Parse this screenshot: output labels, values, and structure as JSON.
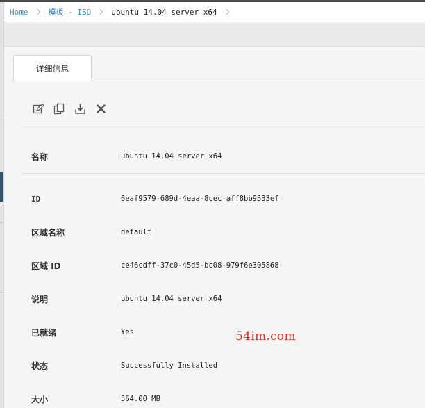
{
  "breadcrumb": {
    "items": [
      {
        "label": "Home"
      },
      {
        "label": "模板 - ISO"
      },
      {
        "label": "ubuntu 14.04 server x64"
      }
    ]
  },
  "tabs": [
    {
      "label": "详细信息",
      "active": true
    }
  ],
  "actions": [
    {
      "name": "edit",
      "icon": "edit-icon"
    },
    {
      "name": "copy",
      "icon": "copy-icon"
    },
    {
      "name": "download",
      "icon": "download-icon"
    },
    {
      "name": "delete",
      "icon": "delete-icon"
    }
  ],
  "details": [
    {
      "label": "名称",
      "value": "ubuntu 14.04 server x64"
    },
    {
      "label": "ID",
      "value": "6eaf9579-689d-4eaa-8cec-aff8bb9533ef"
    },
    {
      "label": "区域名称",
      "value": "default"
    },
    {
      "label": "区域 ID",
      "value": "ce46cdff-37c0-45d5-bc08-979f6e305868"
    },
    {
      "label": "说明",
      "value": "ubuntu 14.04 server x64"
    },
    {
      "label": "已就绪",
      "value": "Yes"
    },
    {
      "label": "状态",
      "value": "Successfully Installed"
    },
    {
      "label": "大小",
      "value": "564.00 MB"
    }
  ],
  "watermark": "54im.com",
  "colors": {
    "link": "#3c8ed6",
    "watermark": "#e8312a",
    "panel_bg": "#f5f5f5"
  }
}
